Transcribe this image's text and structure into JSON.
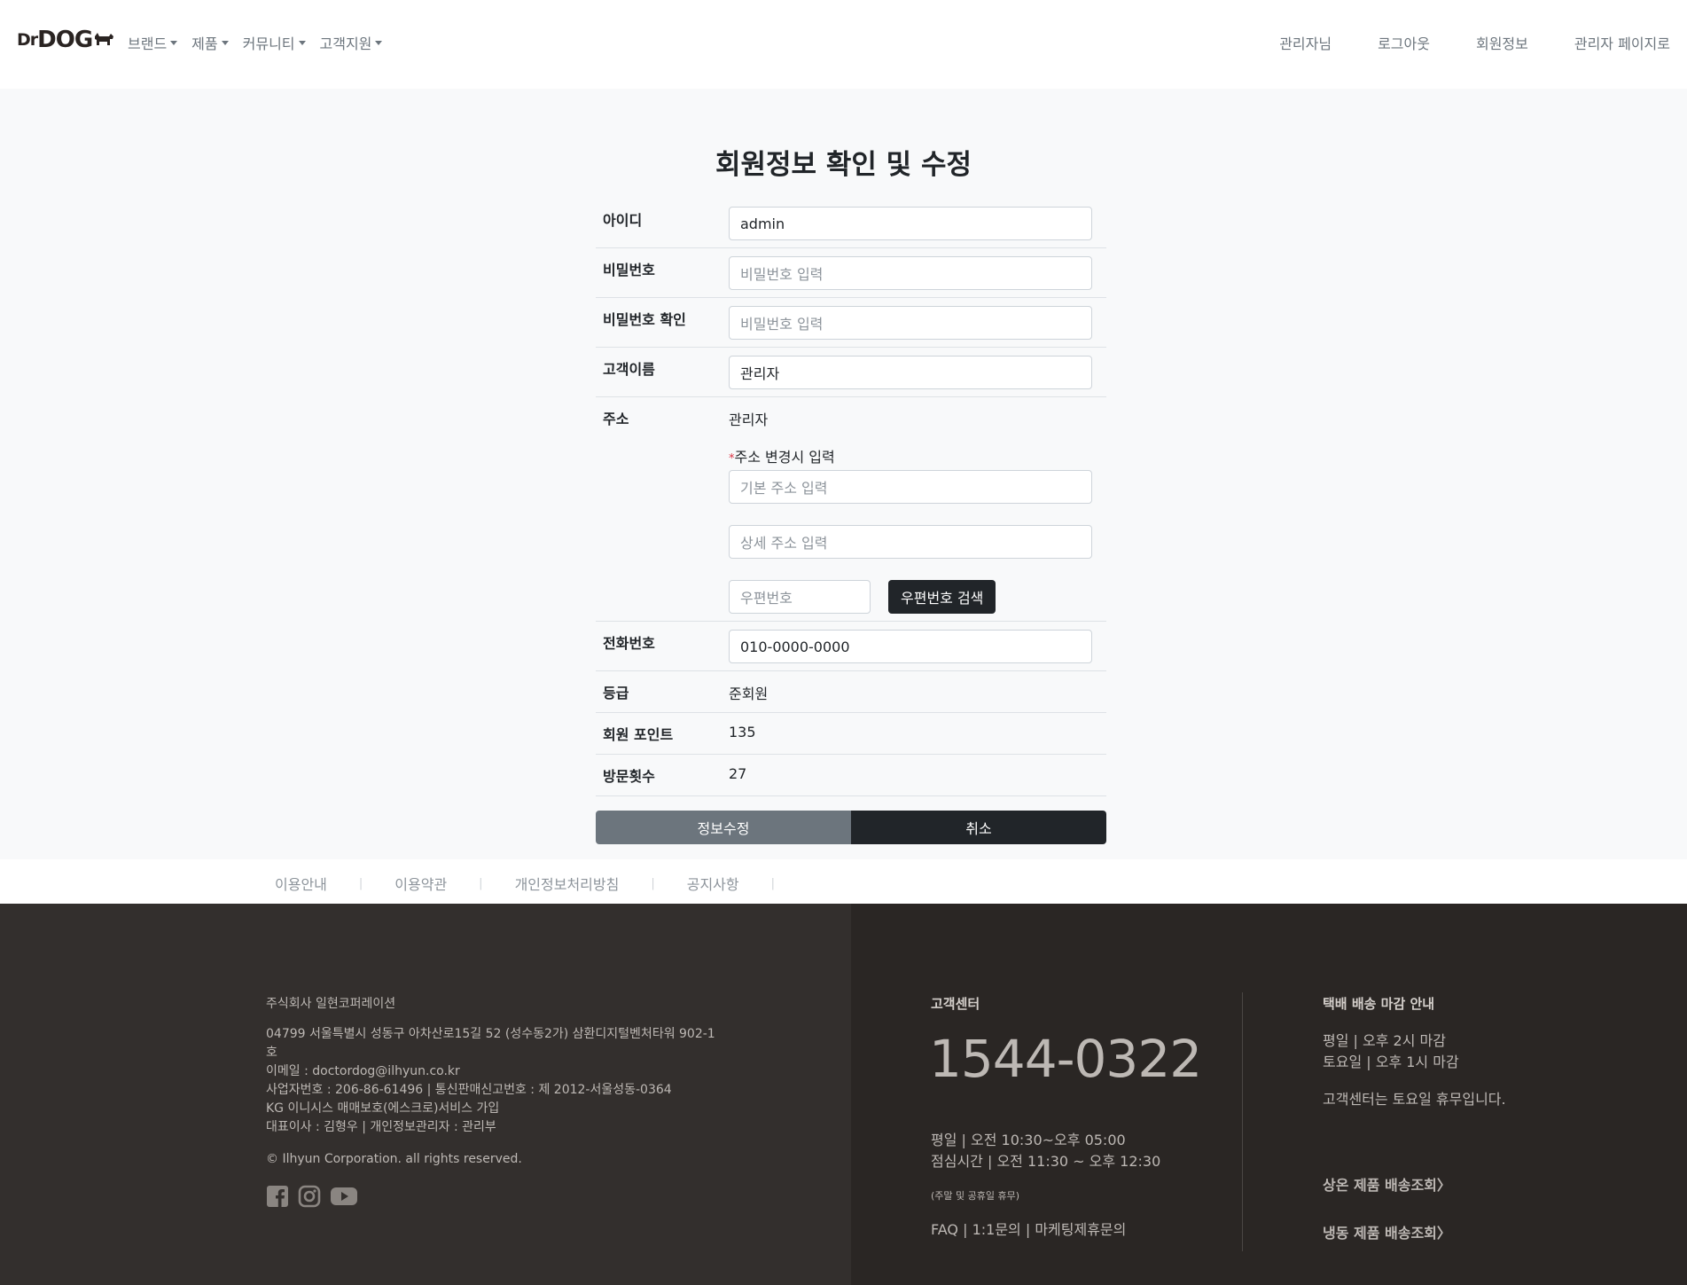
{
  "nav": {
    "logo_dr": "Dr",
    "logo_dog": "DOG",
    "left_menu": [
      "브랜드",
      "제품",
      "커뮤니티",
      "고객지원"
    ],
    "right_menu": [
      "관리자님",
      "로그아웃",
      "회원정보",
      "관리자 페이지로"
    ]
  },
  "page": {
    "title": "회원정보 확인 및 수정"
  },
  "form": {
    "id_label": "아이디",
    "id_value": "admin",
    "password_label": "비밀번호",
    "password_placeholder": "비밀번호 입력",
    "password_confirm_label": "비밀번호 확인",
    "password_confirm_placeholder": "비밀번호 입력",
    "name_label": "고객이름",
    "name_value": "관리자",
    "address_label": "주소",
    "address_current": "관리자",
    "address_required_mark": "*",
    "address_note": "주소 변경시 입력",
    "address_basic_placeholder": "기본 주소 입력",
    "address_detail_placeholder": "상세 주소 입력",
    "zip_placeholder": "우편번호",
    "zip_search_button": "우편번호 검색",
    "phone_label": "전화번호",
    "phone_value": "010-0000-0000",
    "grade_label": "등급",
    "grade_value": "준회원",
    "points_label": "회원 포인트",
    "points_value": "135",
    "visits_label": "방문횟수",
    "visits_value": "27",
    "update_button": "정보수정",
    "cancel_button": "취소"
  },
  "footer_links": [
    "이용안내",
    "이용약관",
    "개인정보처리방침",
    "공지사항"
  ],
  "footer": {
    "company": "주식회사 일현코퍼레이션",
    "address": "04799 서울특별시 성동구 아차산로15길 52 (성수동2가) 삼환디지털벤처타워 902-1호",
    "email": "이메일 : doctordog@ilhyun.co.kr",
    "business": "사업자번호 : 206-86-61496 | 통신판매신고번호 : 제 2012-서울성동-0364",
    "escrow": "KG 이니시스 매매보호(에스크로)서비스 가입",
    "ceo": "대표이사 : 김형우 | 개인정보관리자 : 관리부",
    "copyright": "© Ilhyun Corporation. all rights reserved.",
    "social": [
      "facebook-icon",
      "instagram-icon",
      "youtube-icon"
    ],
    "cs_title": "고객센터",
    "cs_phone": "1544-0322",
    "cs_weekday": "평일 | 오전 10:30~오후 05:00",
    "cs_lunch": "점심시간 | 오전 11:30 ~ 오후 12:30",
    "cs_holiday": "(주말 및 공휴일 휴무)",
    "cs_faq": "FAQ",
    "cs_inquiry": "1:1문의",
    "cs_marketing": "마케팅제휴문의",
    "delivery_title": "택배 배송 마감 안내",
    "delivery_weekday": "평일 | 오후 2시 마감",
    "delivery_saturday": "토요일 | 오후 1시 마감",
    "delivery_note": "고객센터는 토요일 휴무입니다.",
    "delivery_room_temp": "상온 제품 배송조회",
    "delivery_frozen": "냉동 제품 배송조회"
  }
}
